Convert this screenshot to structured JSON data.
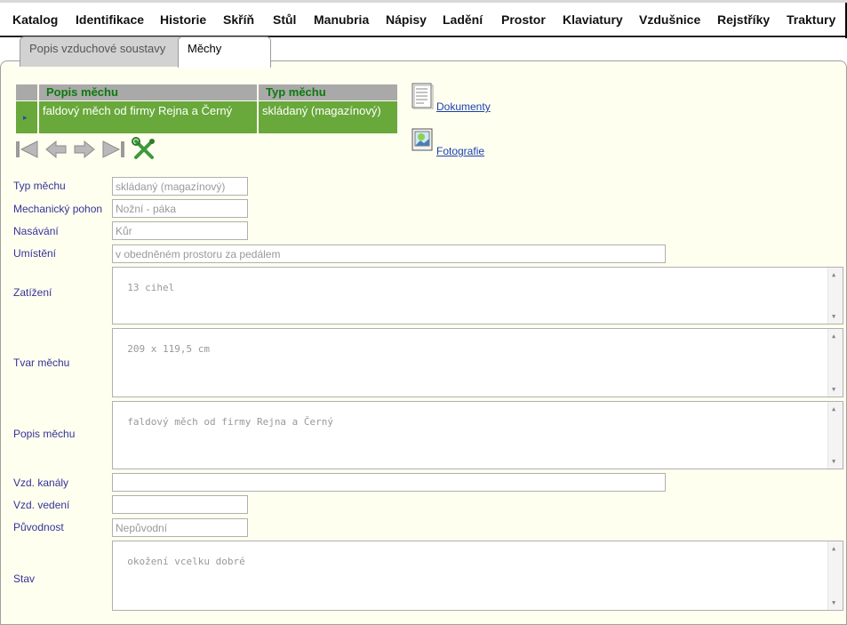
{
  "menu": {
    "items": [
      "Katalog",
      "Identifikace",
      "Historie",
      "Skříň",
      "Stůl",
      "Manubria",
      "Nápisy",
      "Ladění",
      "Prostor",
      "Klaviatury",
      "Vzdušnice",
      "Rejstříky",
      "Traktury"
    ]
  },
  "tabs": [
    {
      "label": "Popis vzduchové soustavy"
    },
    {
      "label": "Měchy"
    }
  ],
  "grid": {
    "headers": [
      "Popis měchu",
      "Typ měchu"
    ],
    "rows": [
      {
        "popis": "faldový měch od firmy Rejna a Černý",
        "typ": "skládaný (magazínový)"
      }
    ],
    "row_indicator": "▸"
  },
  "nav": [
    "first-record-icon",
    "previous-record-icon",
    "next-record-icon",
    "last-record-icon",
    "tools-icon"
  ],
  "links": {
    "dokumenty": "Dokumenty",
    "fotografie": "Fotografie"
  },
  "form": {
    "typ_mechu": {
      "label": "Typ měchu",
      "value": "skládaný (magazínový)"
    },
    "pohon": {
      "label": "Mechanický pohon",
      "value": "Nožní - páka"
    },
    "nasavani": {
      "label": "Nasávání",
      "value": "Kůr"
    },
    "umisteni": {
      "label": "Umístění",
      "value": "v obedněném prostoru za pedálem"
    },
    "zatizeni": {
      "label": "Zatížení",
      "value": "13 cihel"
    },
    "tvar": {
      "label": "Tvar měchu",
      "value": "209 x 119,5 cm"
    },
    "popis": {
      "label": "Popis měchu",
      "value": "faldový měch od firmy Rejna a Černý"
    },
    "kanaly": {
      "label": "Vzd. kanály",
      "value": ""
    },
    "vedeni": {
      "label": "Vzd. vedení",
      "value": ""
    },
    "puvodnost": {
      "label": "Původnost",
      "value": "Nepůvodní"
    },
    "stav": {
      "label": "Stav",
      "value": "okožení vcelku dobré"
    }
  },
  "colors": {
    "panel_bg": "#fffff0",
    "grid_header_bg": "#a9a9a9",
    "grid_header_text": "#0c7a0c",
    "grid_row_bg": "#69a83a",
    "label_text": "#333399",
    "link_text": "#1a3fb0"
  }
}
